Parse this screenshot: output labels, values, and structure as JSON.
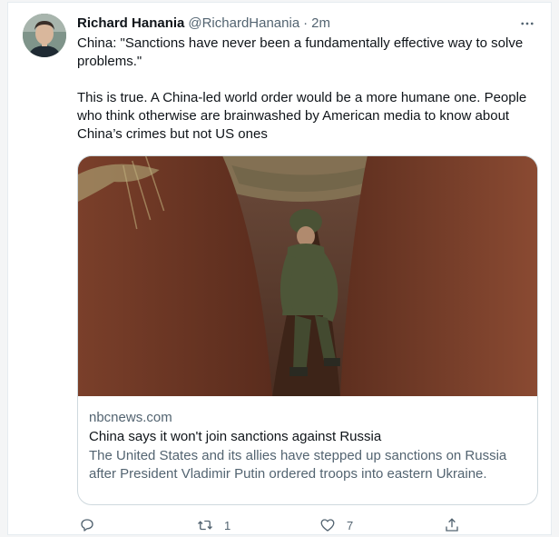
{
  "tweet": {
    "author": {
      "display_name": "Richard Hanania",
      "handle": "@RichardHanania",
      "separator": "·",
      "time": "2m"
    },
    "text": {
      "para1": "China: \"Sanctions have never been a fundamentally effective way to solve problems.\"",
      "para2": "This is true. A China-led world order would be a more humane one. People who think otherwise are brainwashed by American media to know about China’s crimes but not US ones"
    },
    "card": {
      "domain": "nbcnews.com",
      "title": "China says it won't join sanctions against Russia",
      "description": "The United States and its allies have stepped up sanctions on Russia after President Vladimir Putin ordered troops into eastern Ukraine."
    },
    "actions": {
      "reply_icon": "reply-icon",
      "retweet_icon": "retweet-icon",
      "retweet_count": "1",
      "like_icon": "like-icon",
      "like_count": "7",
      "share_icon": "share-icon"
    },
    "more_icon": "more-icon"
  },
  "colors": {
    "text_primary": "#0f1419",
    "text_secondary": "#536471",
    "border": "#cfd9de"
  }
}
